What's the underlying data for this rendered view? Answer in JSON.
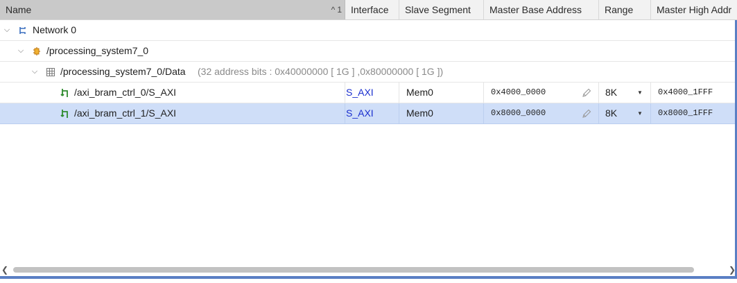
{
  "columns": {
    "name": "Name",
    "sort_indicator": "1",
    "interface": "Interface",
    "slave_segment": "Slave Segment",
    "master_base_address": "Master Base Address",
    "range": "Range",
    "master_high_address": "Master High Addr"
  },
  "tree": {
    "network": {
      "label": "Network 0"
    },
    "ps7": {
      "label": "/processing_system7_0"
    },
    "data": {
      "label": "/processing_system7_0/Data",
      "detail": "(32 address bits : 0x40000000 [ 1G ] ,0x80000000 [ 1G ])"
    }
  },
  "rows": [
    {
      "name": "/axi_bram_ctrl_0/S_AXI",
      "interface": "S_AXI",
      "slave_segment": "Mem0",
      "master_base_address": "0x4000_0000",
      "range": "8K",
      "master_high_address": "0x4000_1FFF",
      "selected": false
    },
    {
      "name": "/axi_bram_ctrl_1/S_AXI",
      "interface": "S_AXI",
      "slave_segment": "Mem0",
      "master_base_address": "0x8000_0000",
      "range": "8K",
      "master_high_address": "0x8000_1FFF",
      "selected": true
    }
  ],
  "colors": {
    "selection": "#cfdef8",
    "link": "#1a2fcf",
    "header_sorted": "#c9c9c9",
    "accent": "#5a7fc4"
  }
}
